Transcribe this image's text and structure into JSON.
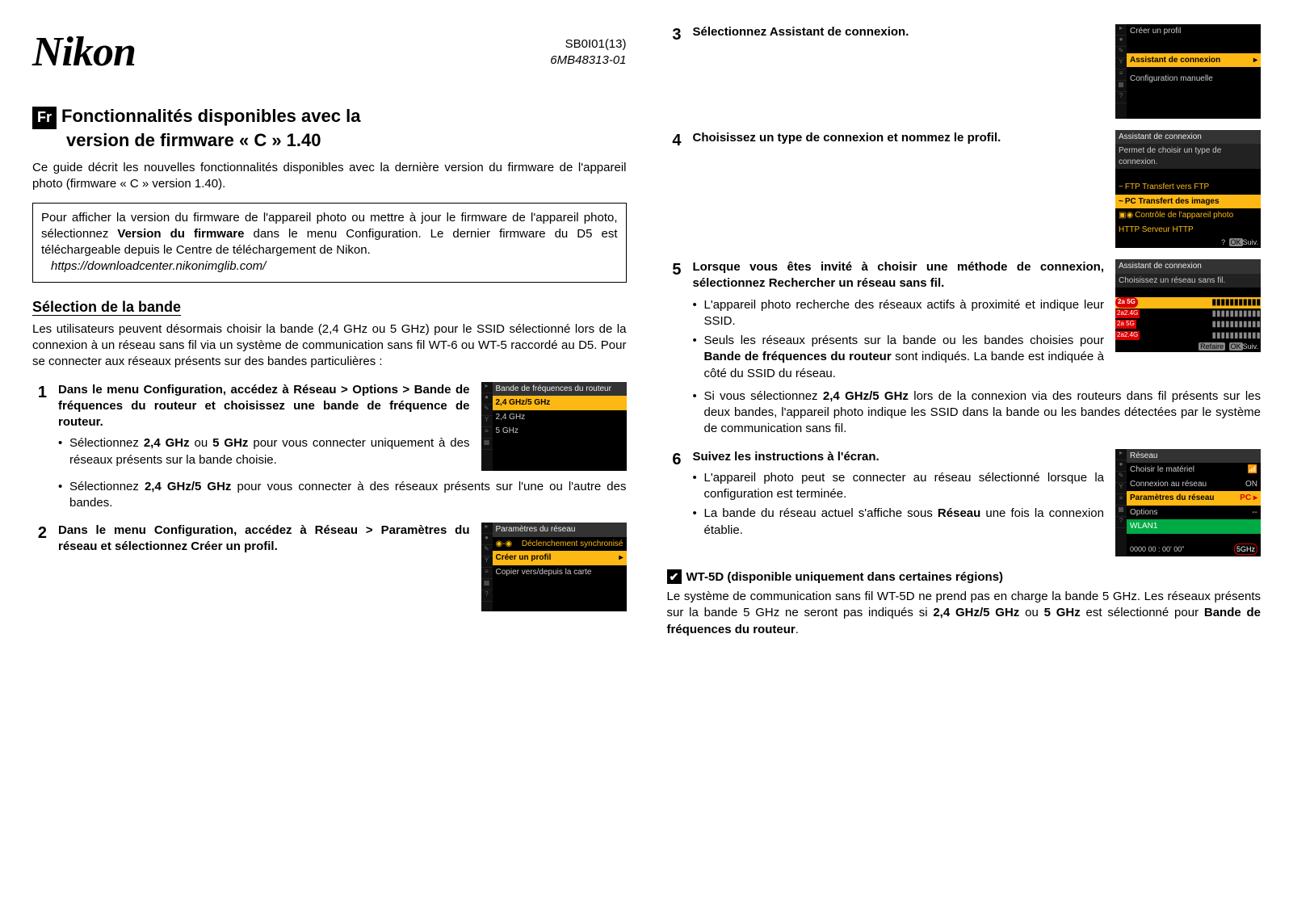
{
  "header": {
    "logo": "Nikon",
    "code1": "SB0I01(13)",
    "code2": "6MB48313-01"
  },
  "lang_badge": "Fr",
  "title_line1": "Fonctionnalités disponibles avec la",
  "title_line2": "version de firmware « C » 1.40",
  "intro": "Ce guide décrit les nouvelles fonctionnalités disponibles avec la dernière version du firmware de l'appareil photo (firmware « C » version 1.40).",
  "box": {
    "t1": "Pour afficher la version du firmware de l'appareil photo ou mettre à jour le firmware de l'appareil photo, sélectionnez ",
    "bold": "Version du firmware",
    "t2": " dans le menu Configuration. Le dernier firmware du D5 est téléchargeable depuis le Centre de téléchargement de Nikon.",
    "url": "https://downloadcenter.nikonimglib.com/"
  },
  "sub_heading": "Sélection de la bande",
  "sub_body": "Les utilisateurs peuvent désormais choisir la bande (2,4 GHz ou 5 GHz) pour le SSID sélectionné lors de la connexion à un réseau sans fil via un système de communication sans fil WT-6 ou WT-5 raccordé au D5. Pour se connecter aux réseaux présents sur des bandes particulières :",
  "step1": {
    "num": "1",
    "t1": "Dans le menu Configuration, accédez à ",
    "b1": "Réseau",
    "t2": " > ",
    "b2": "Options",
    "t3": " > ",
    "b3": "Bande de fréquences du routeur",
    "t4": " et choisissez une bande de fréquence de routeur.",
    "li1a": "Sélectionnez ",
    "li1b": "2,4 GHz",
    "li1c": " ou ",
    "li1d": "5 GHz",
    "li1e": " pour vous connecter uniquement à des réseaux présents sur la bande choisie.",
    "li2a": "Sélectionnez ",
    "li2b": "2,4 GHz/5 GHz",
    "li2c": " pour vous connecter à des réseaux présents sur l'une ou l'autre des bandes."
  },
  "shot1": {
    "hdr": "Bande de fréquences du routeur",
    "o1": "2,4 GHz/5 GHz",
    "o2": "2,4 GHz",
    "o3": "5 GHz"
  },
  "step2": {
    "num": "2",
    "t1": "Dans le menu Configuration, accédez à ",
    "b1": "Réseau",
    "t2": " > ",
    "b2": "Paramètres du réseau",
    "t3": " et sélectionnez ",
    "b3": "Créer un profil",
    "t4": "."
  },
  "shot2": {
    "hdr": "Paramètres du réseau",
    "r1": "Déclenchement synchronisé",
    "r2": "Créer un profil",
    "r3": "Copier vers/depuis la carte"
  },
  "step3": {
    "num": "3",
    "t1": "Sélectionnez ",
    "b1": "Assistant de connexion",
    "t2": "."
  },
  "shot3": {
    "r1": "Créer un profil",
    "r2": "Assistant de connexion",
    "r3": "Configuration manuelle"
  },
  "step4": {
    "num": "4",
    "title": "Choisissez un type de connexion et nommez le profil."
  },
  "shot4": {
    "hdr": "Assistant de connexion",
    "sub": "Permet de choisir un type de connexion.",
    "r1": "FTP Transfert vers FTP",
    "r2": "PC Transfert des images",
    "r3": "Contrôle de l'appareil photo",
    "r4": "HTTP Serveur HTTP",
    "ok": "OK",
    "suiv": "Suiv."
  },
  "step5": {
    "num": "5",
    "t1": "Lorsque vous êtes invité à choisir une méthode de connexion, sélectionnez ",
    "b1": "Rechercher un réseau sans fil",
    "t2": ".",
    "li1": "L'appareil photo recherche des réseaux actifs à proximité et indique leur SSID.",
    "li2a": "Seuls les réseaux présents sur la bande ou les bandes choisies pour ",
    "li2b": "Bande de fréquences du routeur",
    "li2c": " sont indiqués. La bande est indiquée à côté du SSID du réseau.",
    "li3a": "Si vous sélectionnez ",
    "li3b": "2,4 GHz/5 GHz",
    "li3c": " lors de la connexion via des routeurs dans fil présents sur les deux bandes, l'appareil photo indique les SSID dans la bande ou les bandes détectées par le système de communication sans fil."
  },
  "shot5": {
    "hdr": "Assistant de connexion",
    "sub": "Choisissez un réseau sans fil.",
    "refaire": "Refaire",
    "ok": "OK",
    "suiv": "Suiv."
  },
  "step6": {
    "num": "6",
    "title": "Suivez les instructions à l'écran.",
    "li1": "L'appareil photo peut se connecter au réseau sélectionné lorsque la configuration est terminée.",
    "li2a": "La bande du réseau actuel s'affiche sous ",
    "li2b": "Réseau",
    "li2c": " une fois la connexion établie."
  },
  "shot6": {
    "hdr": "Réseau",
    "r1": "Choisir le matériel",
    "v1": "",
    "r2": "Connexion au réseau",
    "v2": "ON",
    "r3": "Paramètres du réseau",
    "v3": "PC ▸",
    "r4": "Options",
    "v4": "--",
    "r5": "WLAN1",
    "status": "0000  00 : 00' 00\"",
    "badge": "5GHz"
  },
  "note": {
    "icon": "✔",
    "title": "WT-5D (disponible uniquement dans certaines régions)",
    "b1": "Le système de communication sans fil WT-5D ne prend pas en charge la bande 5 GHz. Les réseaux présents sur la bande 5 GHz ne seront pas indiqués si ",
    "bold1": "2,4 GHz/5 GHz",
    "b2": " ou ",
    "bold2": "5 GHz",
    "b3": " est sélectionné pour ",
    "bold3": "Bande de fréquences du routeur",
    "b4": "."
  }
}
